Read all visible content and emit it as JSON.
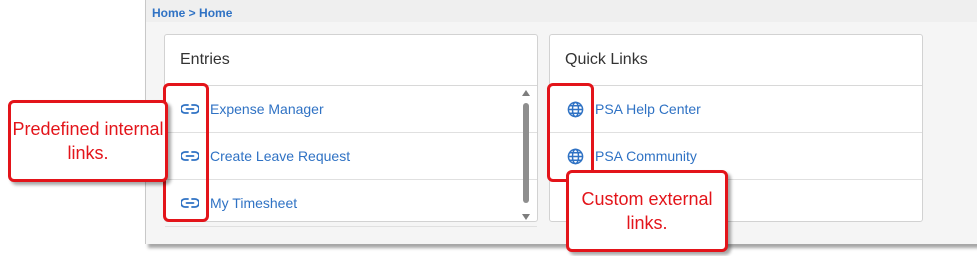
{
  "breadcrumb": {
    "home1": "Home",
    "separator": " > ",
    "home2": "Home"
  },
  "entries": {
    "title": "Entries",
    "items": [
      {
        "label": "Expense Manager",
        "icon": "link-icon"
      },
      {
        "label": "Create Leave Request",
        "icon": "link-icon"
      },
      {
        "label": "My Timesheet",
        "icon": "link-icon"
      }
    ]
  },
  "quick_links": {
    "title": "Quick Links",
    "items": [
      {
        "label": "PSA Help Center",
        "icon": "globe-icon"
      },
      {
        "label": "PSA Community",
        "icon": "globe-icon"
      }
    ]
  },
  "annotations": {
    "internal": "Predefined internal links.",
    "external": "Custom external links."
  },
  "colors": {
    "link": "#2f72c4",
    "callout": "#e3141a"
  }
}
